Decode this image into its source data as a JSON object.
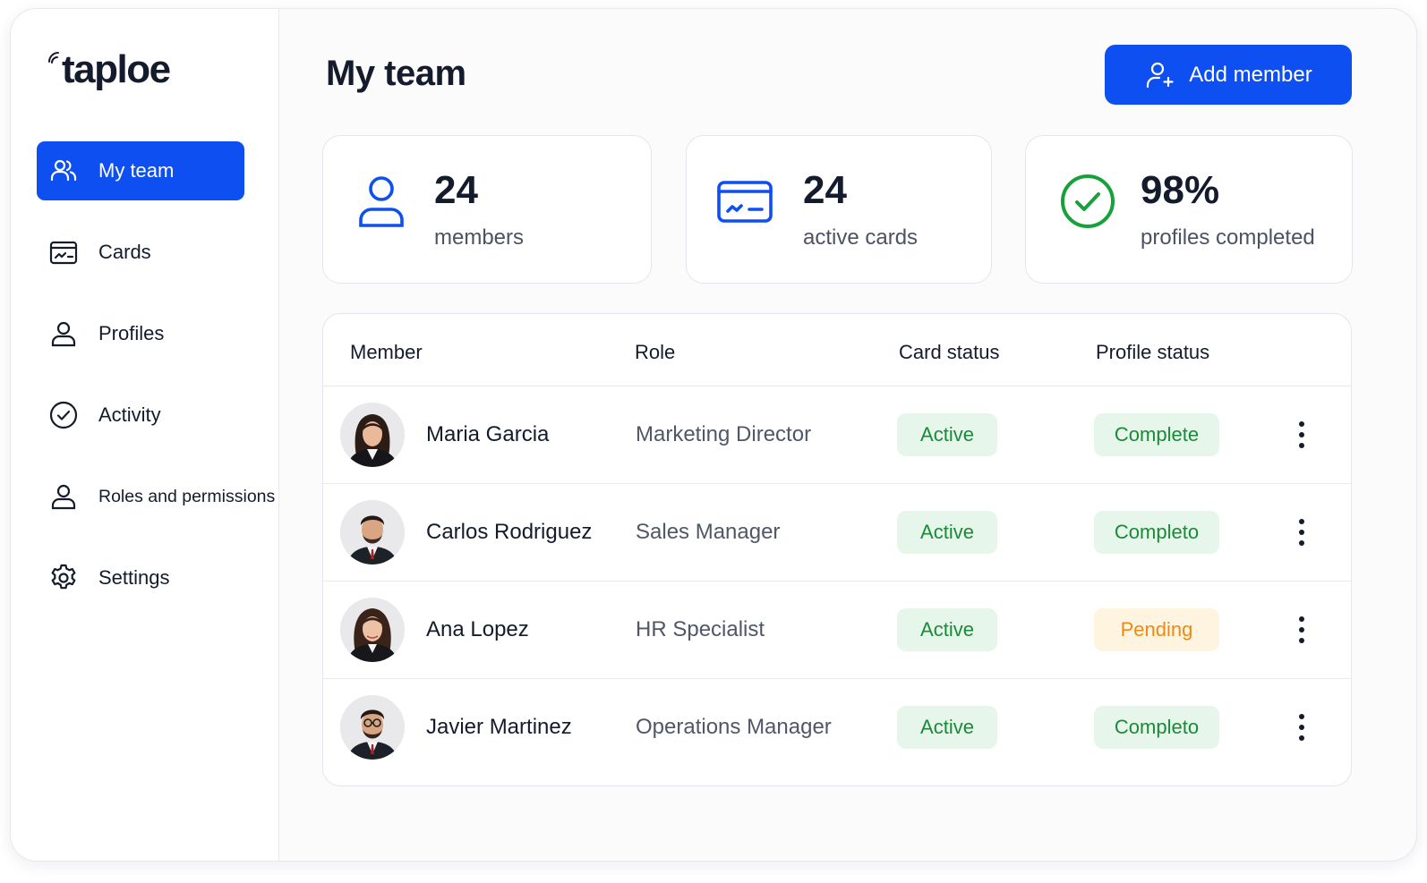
{
  "brand": {
    "name": "taploe"
  },
  "sidebar": {
    "items": [
      {
        "label": "My team",
        "icon": "team-icon",
        "active": true
      },
      {
        "label": "Cards",
        "icon": "card-icon",
        "active": false
      },
      {
        "label": "Profiles",
        "icon": "user-icon",
        "active": false
      },
      {
        "label": "Activity",
        "icon": "check-circle-icon",
        "active": false
      },
      {
        "label": "Roles and permissions",
        "icon": "user-icon",
        "active": false
      },
      {
        "label": "Settings",
        "icon": "gear-icon",
        "active": false
      }
    ]
  },
  "header": {
    "title": "My team",
    "add_button_label": "Add member"
  },
  "stats": [
    {
      "value": "24",
      "label": "members",
      "icon": "user-icon"
    },
    {
      "value": "24",
      "label": "active cards",
      "icon": "card-icon"
    },
    {
      "value": "98%",
      "label": "profiles completed",
      "icon": "check-circle-icon"
    }
  ],
  "table": {
    "columns": [
      "Member",
      "Role",
      "Card status",
      "Profile status"
    ],
    "rows": [
      {
        "name": "Maria Garcia",
        "role": "Marketing Director",
        "card_status": "Active",
        "profile_status": "Complete"
      },
      {
        "name": "Carlos Rodriguez",
        "role": "Sales Manager",
        "card_status": "Active",
        "profile_status": "Completo"
      },
      {
        "name": "Ana Lopez",
        "role": "HR Specialist",
        "card_status": "Active",
        "profile_status": "Pending"
      },
      {
        "name": "Javier Martinez",
        "role": "Operations Manager",
        "card_status": "Active",
        "profile_status": "Completo"
      }
    ]
  },
  "colors": {
    "accent": "#0d4ff0",
    "success_text": "#1a8a39",
    "success_bg": "#e7f6ea",
    "pending_text": "#ec8a16",
    "pending_bg": "#fff4df",
    "check_green": "#17a13b"
  }
}
